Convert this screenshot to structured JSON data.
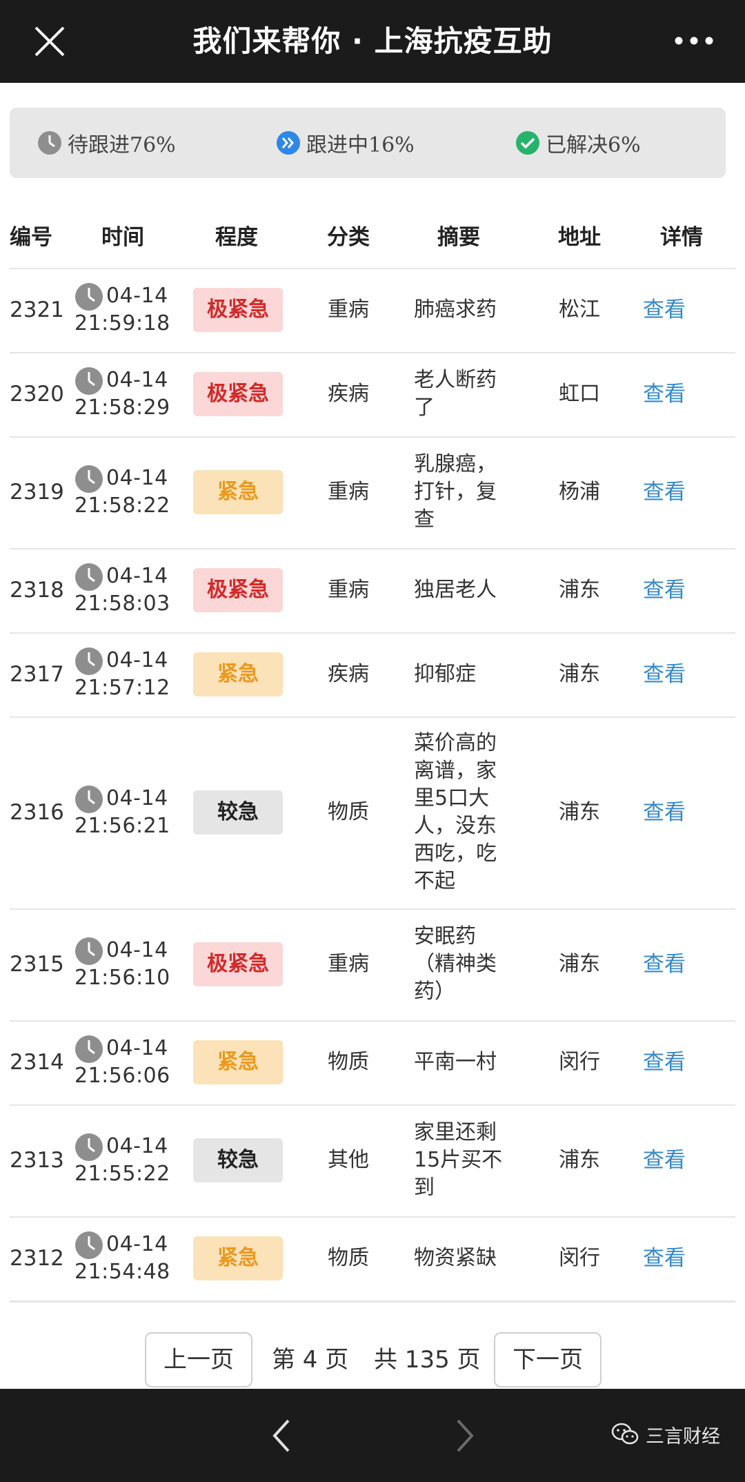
{
  "header": {
    "title": "我们来帮你 · 上海抗疫互助"
  },
  "status": [
    {
      "label": "待跟进76%",
      "icon": "clock-icon",
      "color": "#8e8e8e"
    },
    {
      "label": "跟进中16%",
      "icon": "double-chevron-icon",
      "color": "#2f87e6"
    },
    {
      "label": "已解决6%",
      "icon": "check-circle-icon",
      "color": "#27b36b"
    }
  ],
  "table": {
    "columns": [
      "编号",
      "时间",
      "程度",
      "分类",
      "摘要",
      "地址",
      "详情"
    ],
    "rows": [
      {
        "id": "2321",
        "date": "04-14",
        "time": "21:59:18",
        "level": "极紧急",
        "category": "重病",
        "summary": "肺癌求药",
        "address": "松江",
        "detail": "查看"
      },
      {
        "id": "2320",
        "date": "04-14",
        "time": "21:58:29",
        "level": "极紧急",
        "category": "疾病",
        "summary": "老人断药了",
        "address": "虹口",
        "detail": "查看"
      },
      {
        "id": "2319",
        "date": "04-14",
        "time": "21:58:22",
        "level": "紧急",
        "category": "重病",
        "summary": "乳腺癌，打针，复查",
        "address": "杨浦",
        "detail": "查看"
      },
      {
        "id": "2318",
        "date": "04-14",
        "time": "21:58:03",
        "level": "极紧急",
        "category": "重病",
        "summary": "独居老人",
        "address": "浦东",
        "detail": "查看"
      },
      {
        "id": "2317",
        "date": "04-14",
        "time": "21:57:12",
        "level": "紧急",
        "category": "疾病",
        "summary": "抑郁症",
        "address": "浦东",
        "detail": "查看"
      },
      {
        "id": "2316",
        "date": "04-14",
        "time": "21:56:21",
        "level": "较急",
        "category": "物质",
        "summary": "菜价高的离谱，家里5口大人，没东西吃，吃不起",
        "address": "浦东",
        "detail": "查看"
      },
      {
        "id": "2315",
        "date": "04-14",
        "time": "21:56:10",
        "level": "极紧急",
        "category": "重病",
        "summary": "安眠药（精神类药）",
        "address": "浦东",
        "detail": "查看"
      },
      {
        "id": "2314",
        "date": "04-14",
        "time": "21:56:06",
        "level": "紧急",
        "category": "物质",
        "summary": "平南一村",
        "address": "闵行",
        "detail": "查看"
      },
      {
        "id": "2313",
        "date": "04-14",
        "time": "21:55:22",
        "level": "较急",
        "category": "其他",
        "summary": "家里还剩15片买不到",
        "address": "浦东",
        "detail": "查看"
      },
      {
        "id": "2312",
        "date": "04-14",
        "time": "21:54:48",
        "level": "紧急",
        "category": "物质",
        "summary": "物资紧缺",
        "address": "闵行",
        "detail": "查看"
      }
    ]
  },
  "pager": {
    "prev": "上一页",
    "current": "第 4 页",
    "total": "共 135 页",
    "next": "下一页"
  },
  "footer": {
    "brand": "三言财经"
  },
  "colors": {
    "link": "#3489c9",
    "red": "#d22a2a",
    "orange": "#e99a1e"
  }
}
